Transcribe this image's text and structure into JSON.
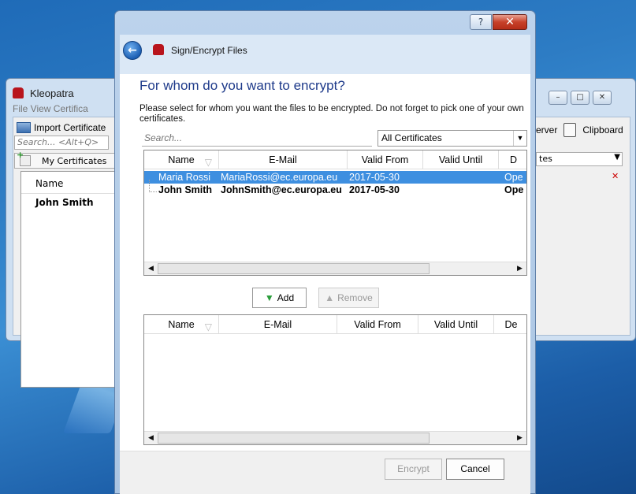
{
  "background_window": {
    "title": "Kleopatra",
    "menu": "File  View  Certifica",
    "import_label": "Import Certificate",
    "search_placeholder": "Search... <Alt+Q>",
    "tab_label": "My Certificates",
    "col_name": "Name",
    "row": "John Smith",
    "right_tool_server": "erver",
    "right_tool_clipboard": "Clipboard",
    "right_combo": "tes"
  },
  "dialog": {
    "title": "Sign/Encrypt Files",
    "help_label": "?",
    "close_label": "✕",
    "heading": "For whom do you want to encrypt?",
    "description": "Please select for whom you want the files to be encrypted. Do not forget to pick one of your own certificates.",
    "search_placeholder": "Search...",
    "filter_value": "All Certificates",
    "columns_top": [
      "Name",
      "E-Mail",
      "Valid From",
      "Valid Until",
      "D"
    ],
    "columns_bottom": [
      "Name",
      "E-Mail",
      "Valid From",
      "Valid Until",
      "De"
    ],
    "rows": [
      {
        "name": "Maria Rossi",
        "email": "MariaRossi@ec.europa.eu",
        "valid_from": "2017-05-30",
        "valid_until": "",
        "details": "Ope"
      },
      {
        "name": "John Smith",
        "email": "JohnSmith@ec.europa.eu",
        "valid_from": "2017-05-30",
        "valid_until": "",
        "details": "Ope"
      }
    ],
    "add_label": "Add",
    "remove_label": "Remove",
    "encrypt_label": "Encrypt",
    "cancel_label": "Cancel"
  },
  "colors": {
    "accent_title": "#1e3a8a",
    "selection": "#3e8fe0",
    "add_arrow": "#2a9d3a",
    "close_button": "#c7412a"
  }
}
